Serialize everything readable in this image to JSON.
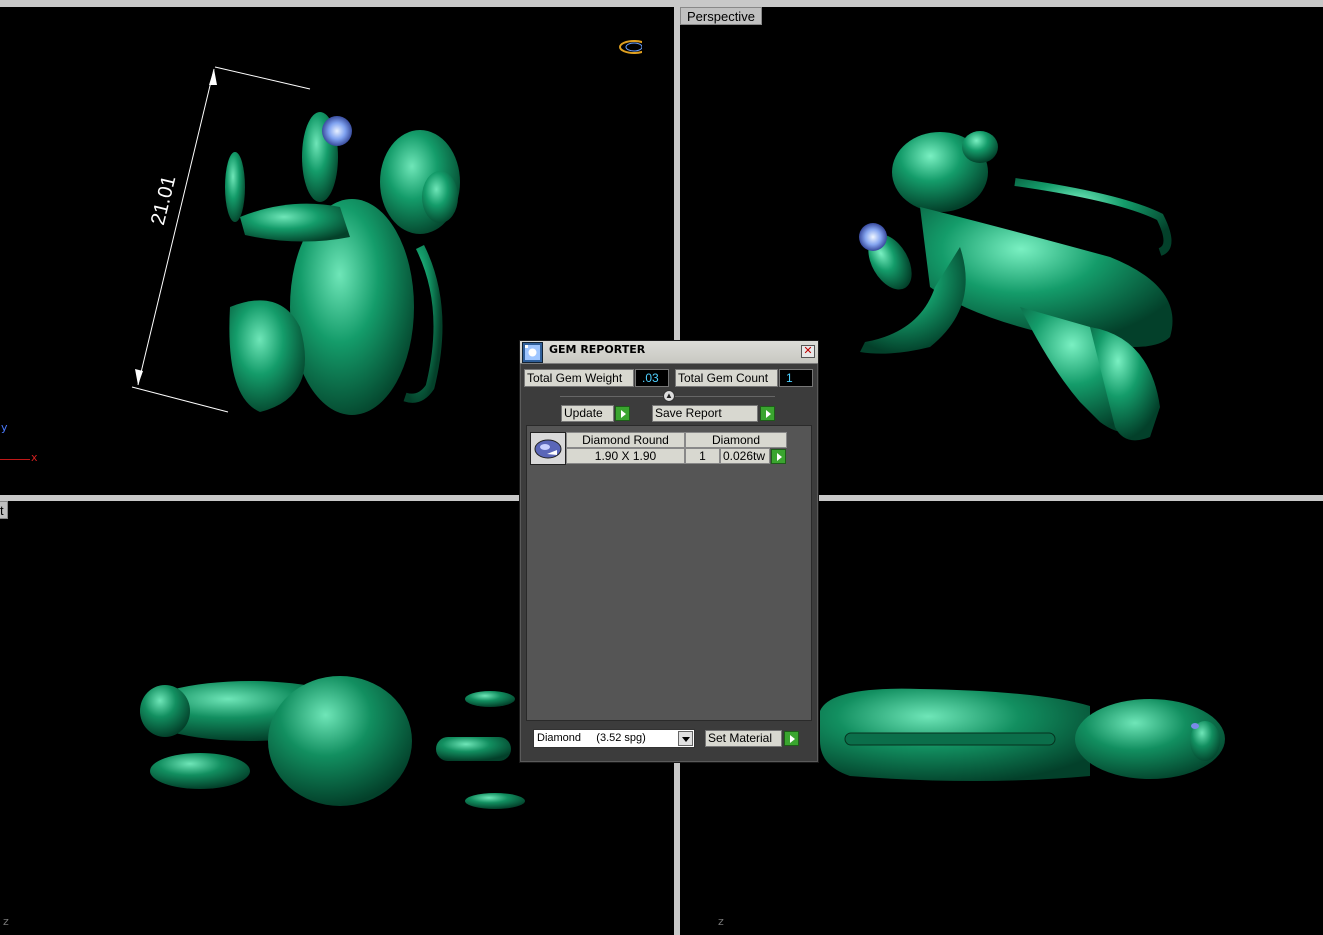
{
  "viewports": {
    "top_left": {
      "label": "",
      "axis_y": "y",
      "axis_x": "x",
      "dimension": "21.01"
    },
    "top_right": {
      "label": "Perspective"
    },
    "bottom_left": {
      "label": "t",
      "axis_z": "z"
    },
    "bottom_right": {
      "axis_z": "z"
    }
  },
  "gem_reporter": {
    "title": "GEM REPORTER",
    "close": "✕",
    "total_gem_weight_label": "Total Gem Weight",
    "total_gem_weight_value": ".03",
    "total_gem_count_label": "Total Gem Count",
    "total_gem_count_value": "1",
    "update_label": "Update",
    "save_report_label": "Save Report",
    "gems": [
      {
        "shape": "Diamond Round",
        "material": "Diamond",
        "size": "1.90 X 1.90",
        "count": "1",
        "weight": "0.026tw"
      }
    ],
    "material_select": "Diamond     (3.52 spg)",
    "set_material_label": "Set Material"
  },
  "colors": {
    "model_green": "#0f8a5e",
    "gem_blue": "#6f8fe8",
    "viewport_bg": "#000000"
  }
}
